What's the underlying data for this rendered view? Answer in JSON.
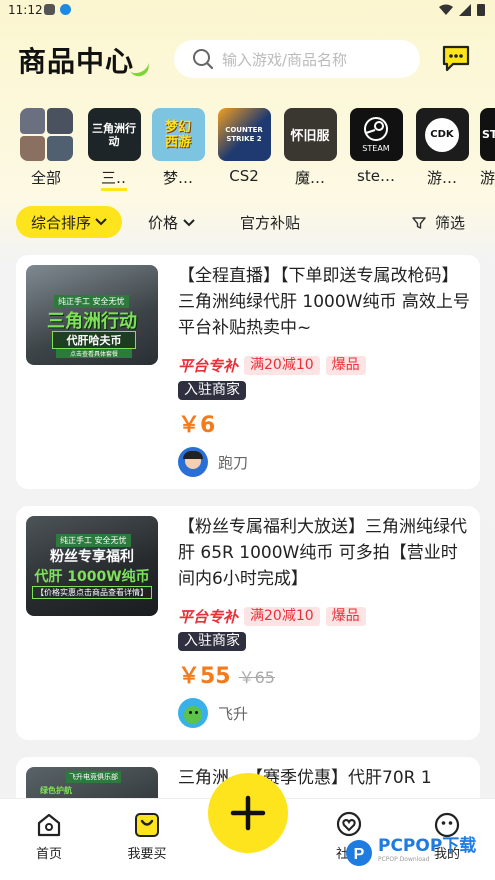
{
  "status_bar": {
    "time": "11:12"
  },
  "header": {
    "title": "商品中心",
    "search_placeholder": "输入游戏/商品名称"
  },
  "games": [
    {
      "label": "全部",
      "icon": "game-collage-icon"
    },
    {
      "label": "三…",
      "icon": "delta-force-icon",
      "logo_text": "三角洲行动"
    },
    {
      "label": "梦…",
      "icon": "menghuan-xiyou-icon",
      "logo_text": "梦幻西游"
    },
    {
      "label": "CS2",
      "icon": "cs2-icon",
      "logo_text": "COUNTER STRIKE 2"
    },
    {
      "label": "魔…",
      "icon": "mo-nostalgia-icon",
      "logo_text": "怀旧服"
    },
    {
      "label": "ste…",
      "icon": "steam-icon",
      "logo_text": "STEAM"
    },
    {
      "label": "游…",
      "icon": "cdk-icon",
      "logo_text": "CDK"
    },
    {
      "label": "游",
      "icon": "st-icon",
      "logo_text": "ST"
    }
  ],
  "filters": {
    "sort": "综合排序",
    "price": "价格",
    "subsidy": "官方补贴",
    "filter": "筛选"
  },
  "products": [
    {
      "title": "【全程直播】【下单即送专属改枪码】三角洲纯绿代肝 1000W纯币 高效上号 平台补贴热卖中~",
      "platform_tag": "平台专补",
      "discount_tag": "满20减10",
      "hot_tag": "爆品",
      "merchant_tag": "入驻商家",
      "price": "￥6",
      "orig_price": "",
      "seller": "跑刀",
      "thumb": {
        "line1": "纯正手工  安全无忧",
        "line2": "三角洲行动",
        "line3": "代肝哈夫币",
        "line4": "点击查看具体套餐"
      }
    },
    {
      "title": "【粉丝专属福利大放送】三角洲纯绿代肝 65R 1000W纯币 可多拍【营业时间内6小时完成】",
      "platform_tag": "平台专补",
      "discount_tag": "满20减10",
      "hot_tag": "爆品",
      "merchant_tag": "入驻商家",
      "price": "￥55",
      "orig_price": "￥65",
      "seller": "飞升",
      "thumb": {
        "line1": "纯正手工  安全无忧",
        "line2": "粉丝专享福利",
        "line3": "代肝 1000W纯币",
        "line4": "【价格实惠点击商品查看详情】"
      }
    },
    {
      "title": "三角洲…【赛季优惠】代肝70R 1",
      "thumb": {
        "line1": "飞升电竞俱乐部",
        "line2": "绿色护航"
      }
    }
  ],
  "bottom_nav": {
    "home": "首页",
    "buy": "我要买",
    "community": "社区",
    "mine": "我的"
  },
  "watermark": {
    "text": "PCPOP下载",
    "sub": "PCPOP Download"
  },
  "colors": {
    "accent": "#fde41c",
    "price": "#f47a1a",
    "tag_red": "#e8303a"
  }
}
